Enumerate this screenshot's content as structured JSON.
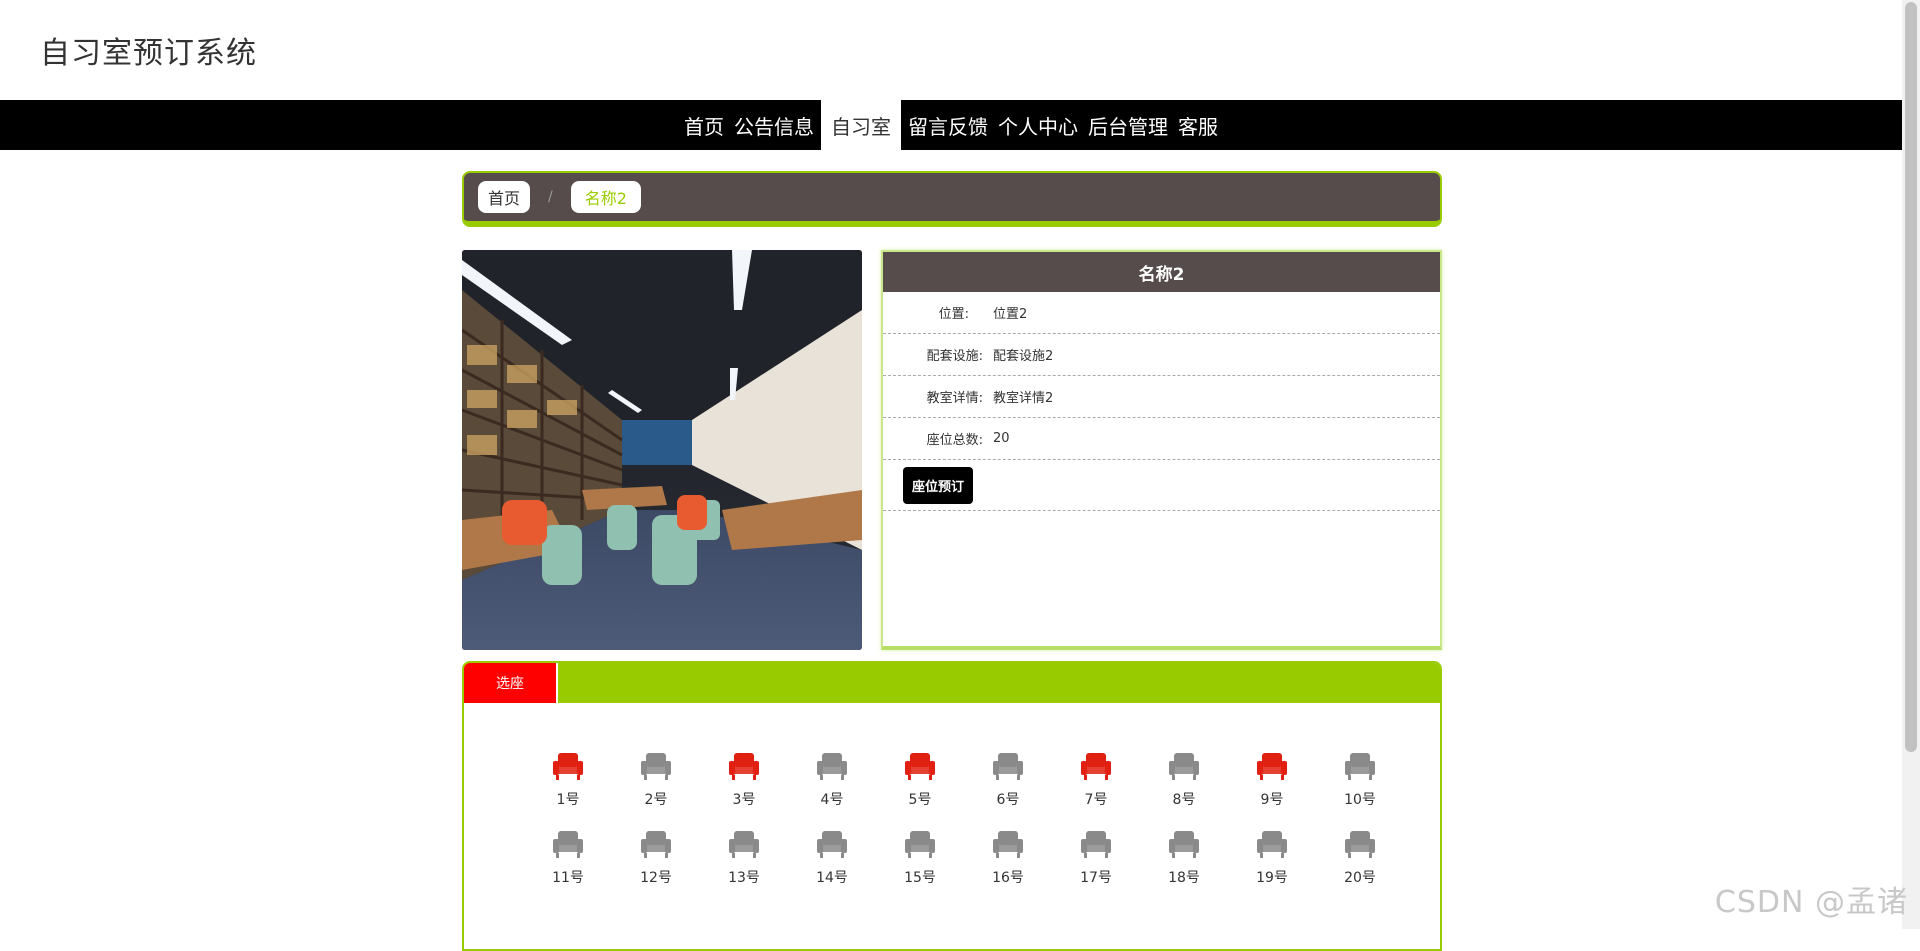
{
  "site": {
    "title": "自习室预订系统"
  },
  "nav": {
    "items": [
      {
        "label": "首页"
      },
      {
        "label": "公告信息"
      },
      {
        "label": "自习室",
        "active": true
      },
      {
        "label": "留言反馈"
      },
      {
        "label": "个人中心"
      },
      {
        "label": "后台管理"
      },
      {
        "label": "客服"
      }
    ]
  },
  "breadcrumb": {
    "home": "首页",
    "separator": "/",
    "current": "名称2"
  },
  "room": {
    "name": "名称2",
    "fields": [
      {
        "label": "位置:",
        "value": "位置2"
      },
      {
        "label": "配套设施:",
        "value": "配套设施2"
      },
      {
        "label": "教室详情:",
        "value": "教室详情2"
      },
      {
        "label": "座位总数:",
        "value": "20"
      }
    ],
    "book_button": "座位预订"
  },
  "seats": {
    "tab_label": "选座",
    "items": [
      {
        "label": "1号",
        "status": "taken"
      },
      {
        "label": "2号",
        "status": "free"
      },
      {
        "label": "3号",
        "status": "taken"
      },
      {
        "label": "4号",
        "status": "free"
      },
      {
        "label": "5号",
        "status": "taken"
      },
      {
        "label": "6号",
        "status": "free"
      },
      {
        "label": "7号",
        "status": "taken"
      },
      {
        "label": "8号",
        "status": "free"
      },
      {
        "label": "9号",
        "status": "taken"
      },
      {
        "label": "10号",
        "status": "free"
      },
      {
        "label": "11号",
        "status": "free"
      },
      {
        "label": "12号",
        "status": "free"
      },
      {
        "label": "13号",
        "status": "free"
      },
      {
        "label": "14号",
        "status": "free"
      },
      {
        "label": "15号",
        "status": "free"
      },
      {
        "label": "16号",
        "status": "free"
      },
      {
        "label": "17号",
        "status": "free"
      },
      {
        "label": "18号",
        "status": "free"
      },
      {
        "label": "19号",
        "status": "free"
      },
      {
        "label": "20号",
        "status": "free"
      }
    ]
  },
  "colors": {
    "accent_green": "#99cc00",
    "header_brown": "#554c4b",
    "seat_taken": "#e02010",
    "seat_free": "#8a8a8a",
    "tab_red": "#ff0000"
  },
  "watermark": "CSDN @孟诸"
}
